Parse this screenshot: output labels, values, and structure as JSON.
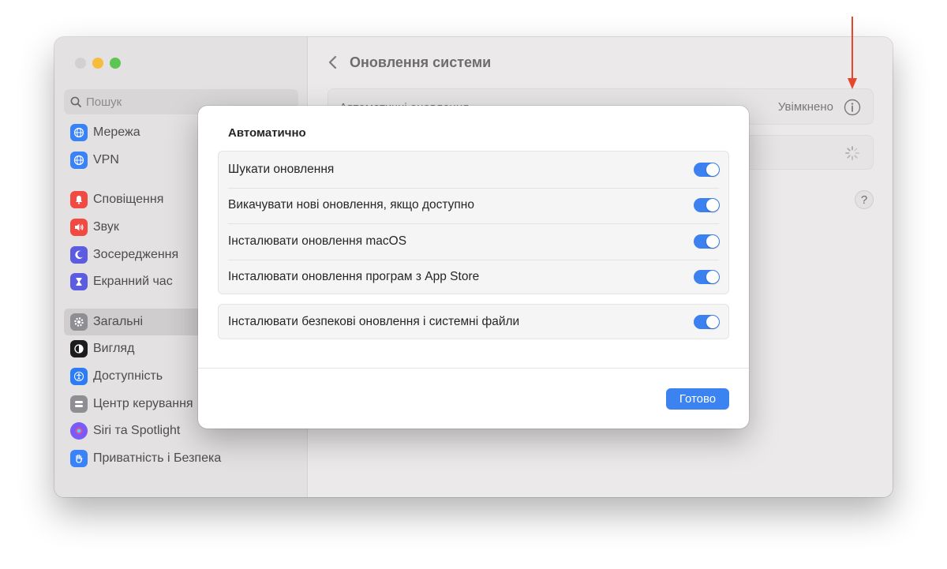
{
  "sidebar": {
    "search_placeholder": "Пошук",
    "items": [
      {
        "label": "Мережа",
        "icon": "globe-icon",
        "color": "#3a82f7"
      },
      {
        "label": "VPN",
        "icon": "globe-icon",
        "color": "#3a82f7"
      },
      {
        "label": "Сповіщення",
        "icon": "bell-icon",
        "color": "#f14a43"
      },
      {
        "label": "Звук",
        "icon": "speaker-icon",
        "color": "#f14a43"
      },
      {
        "label": "Зосередження",
        "icon": "moon-icon",
        "color": "#5c5ce0"
      },
      {
        "label": "Екранний час",
        "icon": "hourglass-icon",
        "color": "#5c5ce0"
      },
      {
        "label": "Загальні",
        "icon": "gear-icon",
        "color": "#8e8e93",
        "selected": true
      },
      {
        "label": "Вигляд",
        "icon": "appearance-icon",
        "color": "#1c1c1e"
      },
      {
        "label": "Доступність",
        "icon": "accessibility-icon",
        "color": "#2b7cf6"
      },
      {
        "label": "Центр керування",
        "icon": "control-center-icon",
        "color": "#8e8e93"
      },
      {
        "label": "Siri та Spotlight",
        "icon": "siri-icon",
        "color": "#7a5af8"
      },
      {
        "label": "Приватність і Безпека",
        "icon": "hand-icon",
        "color": "#3a82f7"
      }
    ]
  },
  "content": {
    "title": "Оновлення системи",
    "auto_updates_label": "Автоматичні оновлення",
    "auto_updates_value": "Увімкнено",
    "help_label": "?"
  },
  "dialog": {
    "title": "Автоматично",
    "options": [
      {
        "label": "Шукати оновлення",
        "on": true
      },
      {
        "label": "Викачувати нові оновлення, якщо доступно",
        "on": true
      },
      {
        "label": "Інсталювати оновлення macOS",
        "on": true
      },
      {
        "label": "Інсталювати оновлення програм з App Store",
        "on": true
      }
    ],
    "security_option": {
      "label": "Інсталювати безпекові оновлення і системні файли",
      "on": true
    },
    "done_label": "Готово"
  },
  "colors": {
    "accent": "#3a83f0",
    "annotation_arrow": "#e8452f"
  }
}
